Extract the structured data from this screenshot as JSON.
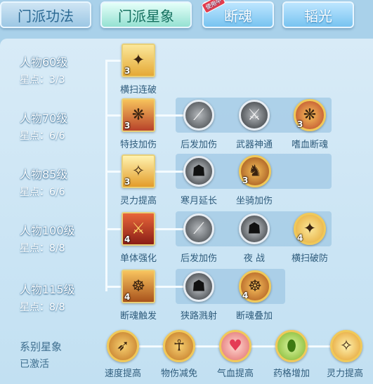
{
  "tabs": [
    {
      "label": "门派功法"
    },
    {
      "label": "门派星象"
    },
    {
      "label": "断魂",
      "badge": "使用中"
    },
    {
      "label": "韬光"
    }
  ],
  "rows": [
    {
      "level": "人物60级",
      "stars": "星点：3/3",
      "main": {
        "label": "横扫连破",
        "count": "3"
      },
      "subs": []
    },
    {
      "level": "人物70级",
      "stars": "星点：6/6",
      "main": {
        "label": "特技加伤",
        "count": "3"
      },
      "subs": [
        {
          "label": "后发加伤",
          "count": ""
        },
        {
          "label": "武器神通",
          "count": ""
        },
        {
          "label": "嗜血断魂",
          "count": "3"
        }
      ]
    },
    {
      "level": "人物85级",
      "stars": "星点：6/6",
      "main": {
        "label": "灵力提高",
        "count": "3"
      },
      "subs": [
        {
          "label": "寒月延长",
          "count": ""
        },
        {
          "label": "坐骑加伤",
          "count": "3"
        }
      ]
    },
    {
      "level": "人物100级",
      "stars": "星点：8/8",
      "main": {
        "label": "单体强化",
        "count": "4"
      },
      "subs": [
        {
          "label": "后发加伤",
          "count": ""
        },
        {
          "label": "夜 战",
          "count": ""
        },
        {
          "label": "横扫破防",
          "count": "4"
        }
      ]
    },
    {
      "level": "人物115级",
      "stars": "星点：8/8",
      "main": {
        "label": "断魂触发",
        "count": "4"
      },
      "subs": [
        {
          "label": "狭路溅射",
          "count": ""
        },
        {
          "label": "断魂叠加",
          "count": "4"
        }
      ]
    }
  ],
  "series": {
    "title": "系别星象",
    "status": "已激活",
    "items": [
      {
        "label": "速度提高"
      },
      {
        "label": "物伤减免"
      },
      {
        "label": "气血提高"
      },
      {
        "label": "药格增加"
      },
      {
        "label": "灵力提高"
      }
    ]
  }
}
